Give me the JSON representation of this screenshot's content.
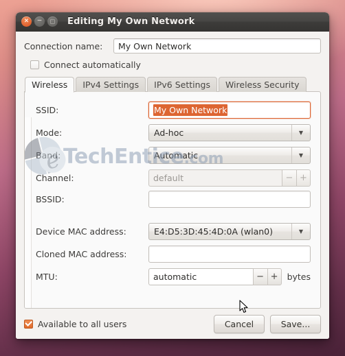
{
  "window": {
    "title": "Editing My Own Network",
    "controls": [
      {
        "name": "close",
        "glyph": "×"
      },
      {
        "name": "minimize",
        "glyph": "−"
      },
      {
        "name": "maximize",
        "glyph": "□"
      }
    ]
  },
  "connection": {
    "label": "Connection name:",
    "value": "My Own Network",
    "autoconnect_label": "Connect automatically",
    "autoconnect_checked": false
  },
  "tabs": [
    {
      "label": "Wireless",
      "active": true
    },
    {
      "label": "IPv4 Settings",
      "active": false
    },
    {
      "label": "IPv6 Settings",
      "active": false
    },
    {
      "label": "Wireless Security",
      "active": false
    }
  ],
  "wireless": {
    "ssid": {
      "label": "SSID:",
      "value": "My Own Network",
      "focused": true,
      "selected": true
    },
    "mode": {
      "label": "Mode:",
      "value": "Ad-hoc"
    },
    "band": {
      "label": "Band:",
      "value": "Automatic"
    },
    "channel": {
      "label": "Channel:",
      "value": "default",
      "disabled": true,
      "minus": "−",
      "plus": "+"
    },
    "bssid": {
      "label": "BSSID:",
      "value": ""
    },
    "device_mac": {
      "label": "Device MAC address:",
      "value": "E4:D5:3D:45:4D:0A (wlan0)"
    },
    "cloned_mac": {
      "label": "Cloned MAC address:",
      "value": ""
    },
    "mtu": {
      "label": "MTU:",
      "value": "automatic",
      "minus": "−",
      "plus": "+",
      "units": "bytes"
    }
  },
  "footer": {
    "available_label": "Available to all users",
    "available_checked": true,
    "cancel_label": "Cancel",
    "save_label": "Save..."
  },
  "watermark": {
    "text": "TechEntice",
    "suffix": ".com"
  },
  "colors": {
    "accent": "#dd6532",
    "titlebar": "#474644",
    "panel": "#fafafa"
  }
}
